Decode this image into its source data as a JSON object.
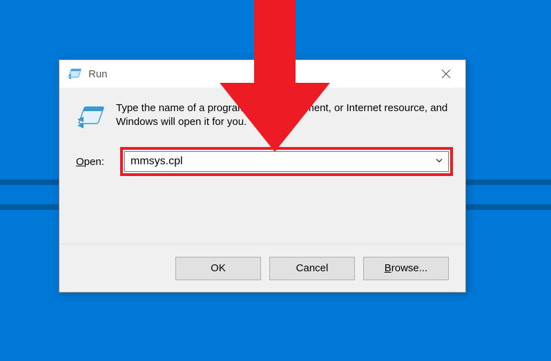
{
  "window": {
    "title": "Run",
    "description": "Type the name of a program, folder, document, or Internet resource, and Windows will open it for you."
  },
  "open": {
    "label_pre": "O",
    "label_rest": "pen:",
    "value": "mmsys.cpl"
  },
  "buttons": {
    "ok": "OK",
    "cancel": "Cancel",
    "browse_pre": "B",
    "browse_rest": "rowse..."
  }
}
